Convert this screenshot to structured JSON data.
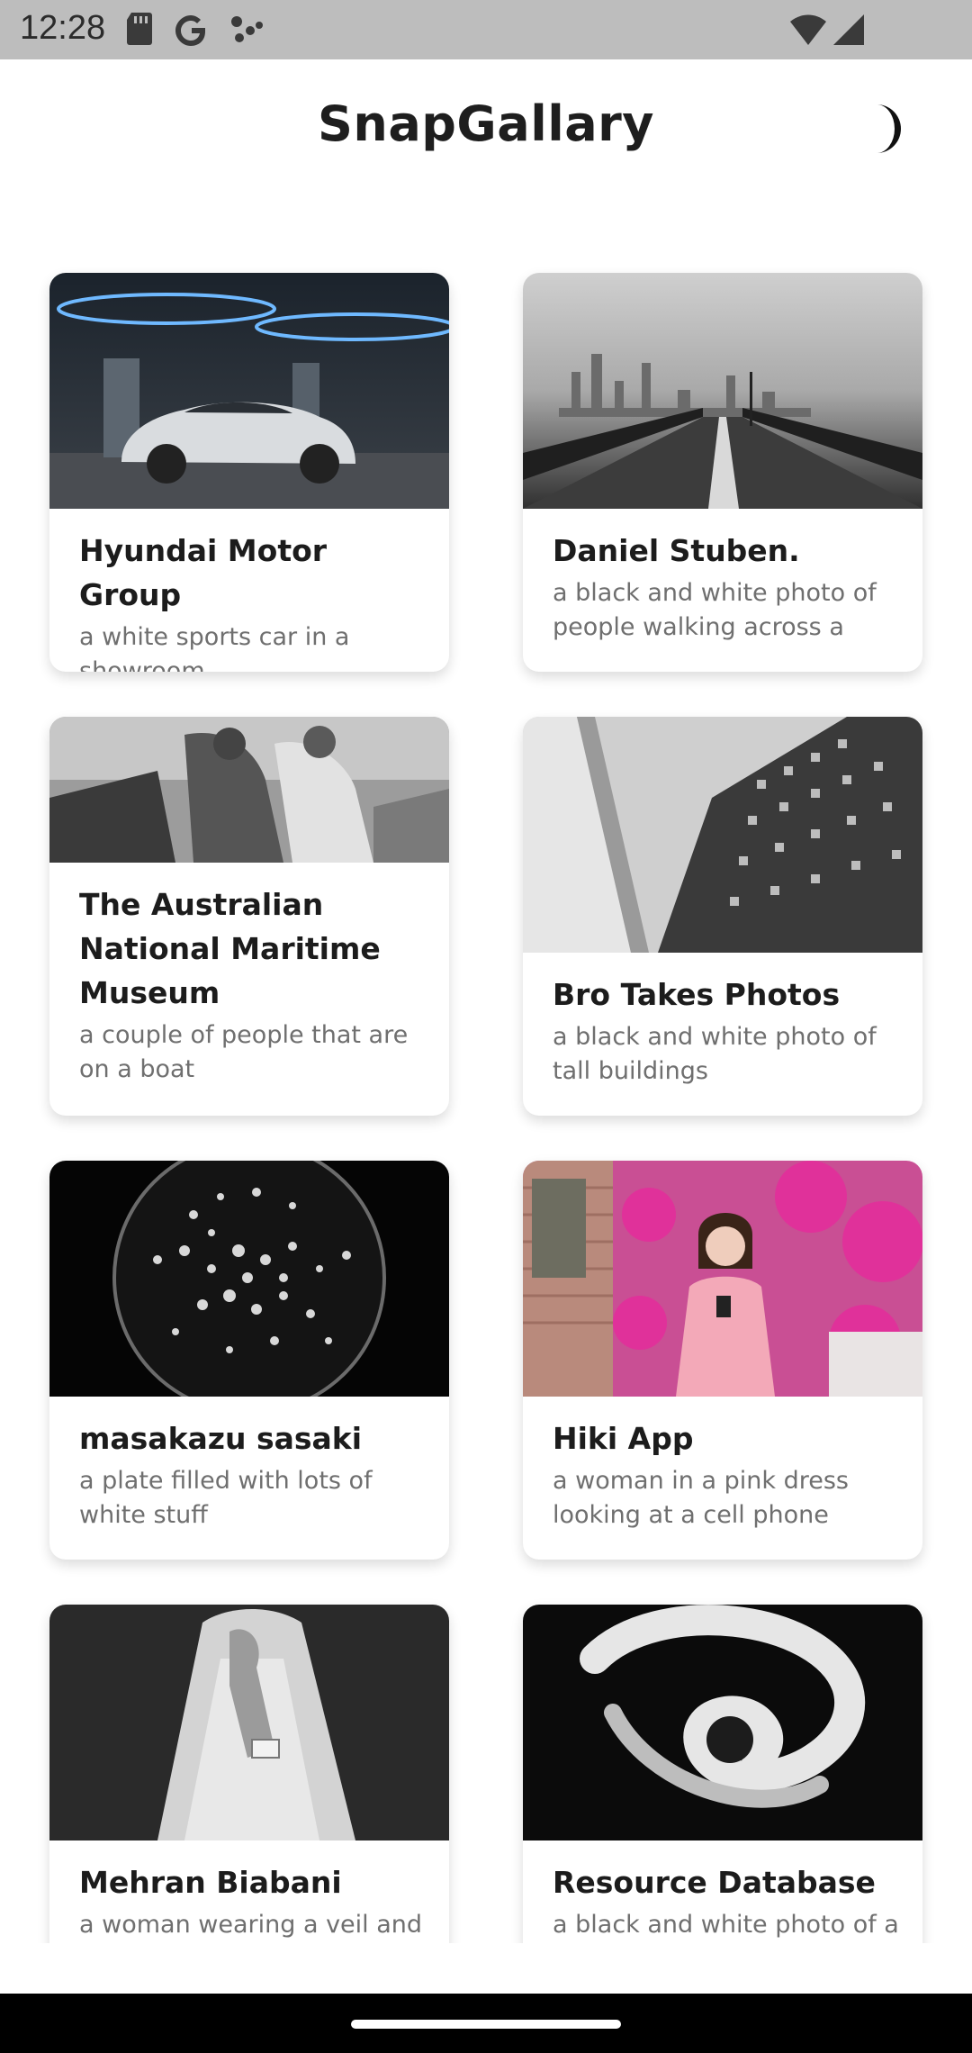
{
  "status_bar": {
    "time": "12:28",
    "icons": [
      "sd-card-icon",
      "google-icon",
      "dots-icon",
      "wifi-icon",
      "signal-icon"
    ]
  },
  "header": {
    "title": "SnapGallary",
    "theme_icon": "moon-icon"
  },
  "cards": [
    {
      "title": "Hyundai Motor Group",
      "description": "a white sports car in a showroom"
    },
    {
      "title": "Daniel Stuben.",
      "description": "a black and white photo of people walking across a"
    },
    {
      "title": "The Australian National Maritime Museum",
      "description": "a couple of people that are on a boat"
    },
    {
      "title": "Bro Takes Photos",
      "description": "a black and white photo of tall buildings"
    },
    {
      "title": "masakazu sasaki",
      "description": "a plate filled with lots of white stuff"
    },
    {
      "title": "Hiki App",
      "description": "a woman in a pink dress looking at a cell phone"
    },
    {
      "title": "Mehran Biabani",
      "description": "a woman wearing a veil and"
    },
    {
      "title": "Resource Database",
      "description": "a black and white photo of a"
    }
  ],
  "colors": {
    "status_bar": "#bdbdbd",
    "title_text": "#1e1e1e",
    "description_text": "#6f6f6f",
    "nav_bar": "#000000"
  }
}
